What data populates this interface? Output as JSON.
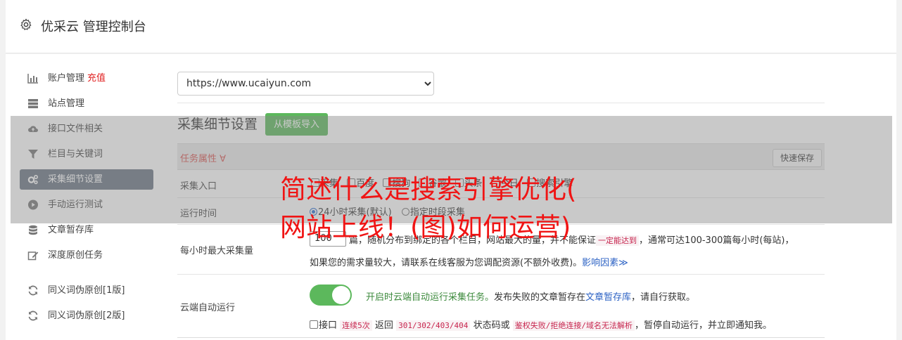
{
  "header": {
    "title": "优采云 管理控制台",
    "icon": "gear-icon"
  },
  "sidebar": {
    "items": [
      {
        "label": "账户管理",
        "extra": "充值",
        "icon": "bar-chart-icon"
      },
      {
        "label": "站点管理",
        "icon": "server-icon"
      },
      {
        "label": "接口文件相关",
        "icon": "cloud-upload-icon"
      },
      {
        "label": "栏目与关键词",
        "icon": "filter-icon"
      },
      {
        "label": "采集细节设置",
        "icon": "cogs-icon",
        "active": true
      },
      {
        "label": "手动运行测试",
        "icon": "play-icon"
      },
      {
        "label": "文章暂存库",
        "icon": "database-icon"
      },
      {
        "label": "深度原创任务",
        "icon": "edit-icon"
      },
      {
        "label": "同义词伪原创[1版]",
        "icon": "refresh-icon"
      },
      {
        "label": "同义词伪原创[2版]",
        "icon": "refresh-icon"
      }
    ]
  },
  "main": {
    "site_select": "https://www.ucaiyun.com",
    "section_title": "采集细节设置",
    "template_button": "从模板导入",
    "task_attr": "任务属性 ∀",
    "quick_save": "快速保存",
    "entry": {
      "label": "采集入口",
      "options": [
        "采集",
        "百度",
        "搜狗",
        "谷歌",
        "头条",
        "今日",
        "搜索引擎"
      ]
    },
    "run_time": {
      "label": "运行时间",
      "opt1": "24小时采集(默认)",
      "opt2": "指定时段采集"
    },
    "max_per_hour": {
      "label": "每小时最大采集量",
      "value": "100",
      "unit": "篇",
      "desc_a": "随机分布到绑定的各个栏目，网站最大的量，并不能保证",
      "desc_code": "一定能达到",
      "desc_b": "，通常可达100-300篇每小时(每站)，",
      "desc_line2": "如果您的需求量较大，请联系在线客服为您调配资源(不额外收费)。",
      "factors_link": "影响因素≫"
    },
    "cloud": {
      "label": "云端自动运行",
      "toggle_on": true,
      "msg_green": "开启时云端自动运行采集任务。",
      "msg_a": "发布失败的文章暂存在",
      "msg_link": "文章暂存库",
      "msg_b": "，请自行获取。",
      "iface": "接口",
      "code1": "连续5次",
      "ret": "返回",
      "code2": "301/302/403/404",
      "status": "状态码或",
      "code3": "鉴权失败/拒绝连接/域名无法解析",
      "tail": "，暂停自动运行，并立即通知我。"
    }
  },
  "overlay": {
    "headline_line1": "简述什么是搜索引擎优化(",
    "headline_line2": "网站上线！(图)如何运营)"
  }
}
